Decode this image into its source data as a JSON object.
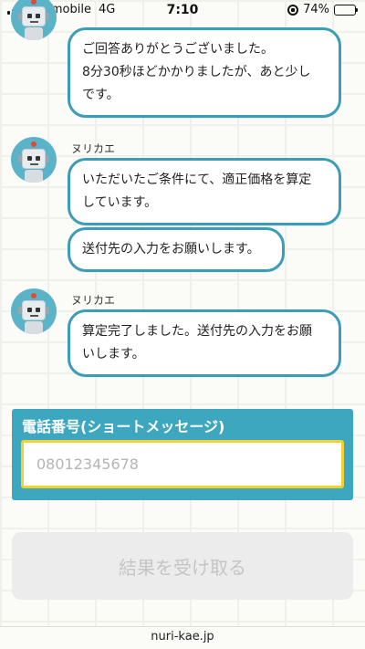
{
  "status_bar": {
    "carrier": "UQ mobile",
    "network": "4G",
    "time": "7:10",
    "battery": "74%",
    "battery_level": 0.74,
    "battery_color": "#f3c623"
  },
  "chat": {
    "messages": [
      {
        "sender": "",
        "text_lines": [
          "ご回答ありがとうございました。",
          "8分30秒ほどかかりましたが、あと少し",
          "です。"
        ]
      },
      {
        "sender": "ヌリカエ",
        "text_lines": [
          "いただいたご条件にて、適正価格を算定",
          "しています。"
        ]
      },
      {
        "sender": "",
        "text_lines": [
          "送付先の入力をお願いします。"
        ]
      },
      {
        "sender": "ヌリカエ",
        "text_lines": [
          "算定完了しました。送付先の入力をお願",
          "いします。"
        ]
      }
    ]
  },
  "form": {
    "phone_label": "電話番号(ショートメッセージ)",
    "phone_placeholder": "08012345678",
    "submit_label": "結果を受け取る"
  },
  "footer": {
    "domain": "nuri-kae.jp"
  },
  "colors": {
    "accent": "#3ca7bf",
    "bubble_border": "#3c9db8",
    "input_border": "#f3d22f"
  },
  "icons": [
    "signal-icon",
    "orientation-lock-icon",
    "battery-icon",
    "robot-avatar-icon"
  ]
}
